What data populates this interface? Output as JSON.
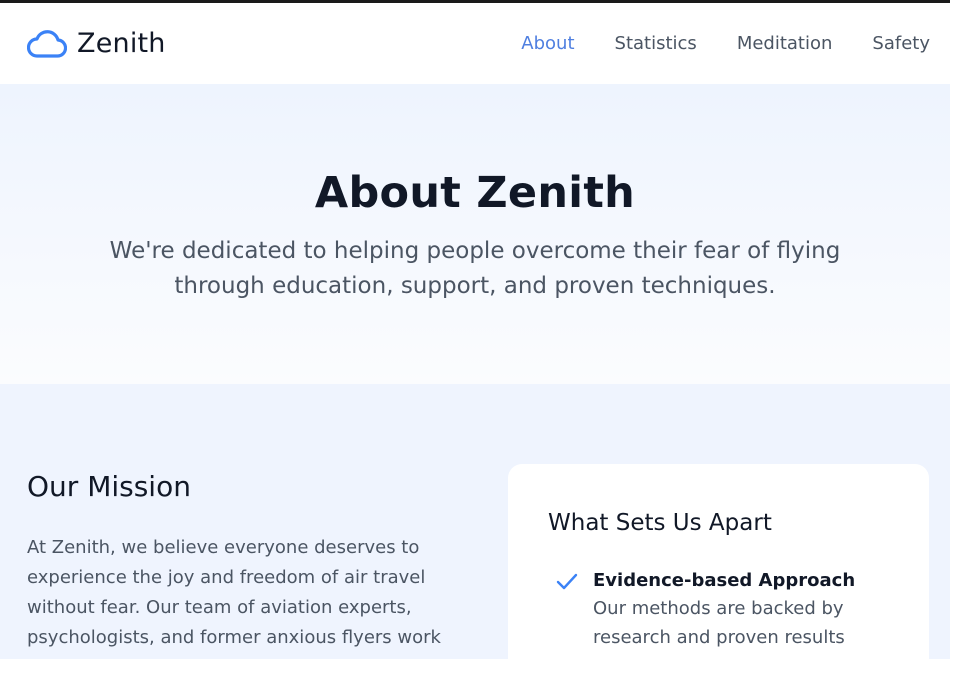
{
  "brand": {
    "name": "Zenith",
    "icon": "cloud-icon",
    "accent": "#3b82f6"
  },
  "nav": {
    "items": [
      {
        "label": "About",
        "active": true
      },
      {
        "label": "Statistics",
        "active": false
      },
      {
        "label": "Meditation",
        "active": false
      },
      {
        "label": "Safety",
        "active": false
      }
    ]
  },
  "hero": {
    "title": "About Zenith",
    "subtitle": "We're dedicated to helping people overcome their fear of flying through education, support, and proven techniques."
  },
  "mission": {
    "title": "Our Mission",
    "body": "At Zenith, we believe everyone deserves to experience the joy and freedom of air travel without fear. Our team of aviation experts, psychologists, and former anxious flyers work"
  },
  "apart": {
    "title": "What Sets Us Apart",
    "features": [
      {
        "icon": "check-icon",
        "title": "Evidence-based Approach",
        "description": "Our methods are backed by research and proven results"
      }
    ]
  }
}
